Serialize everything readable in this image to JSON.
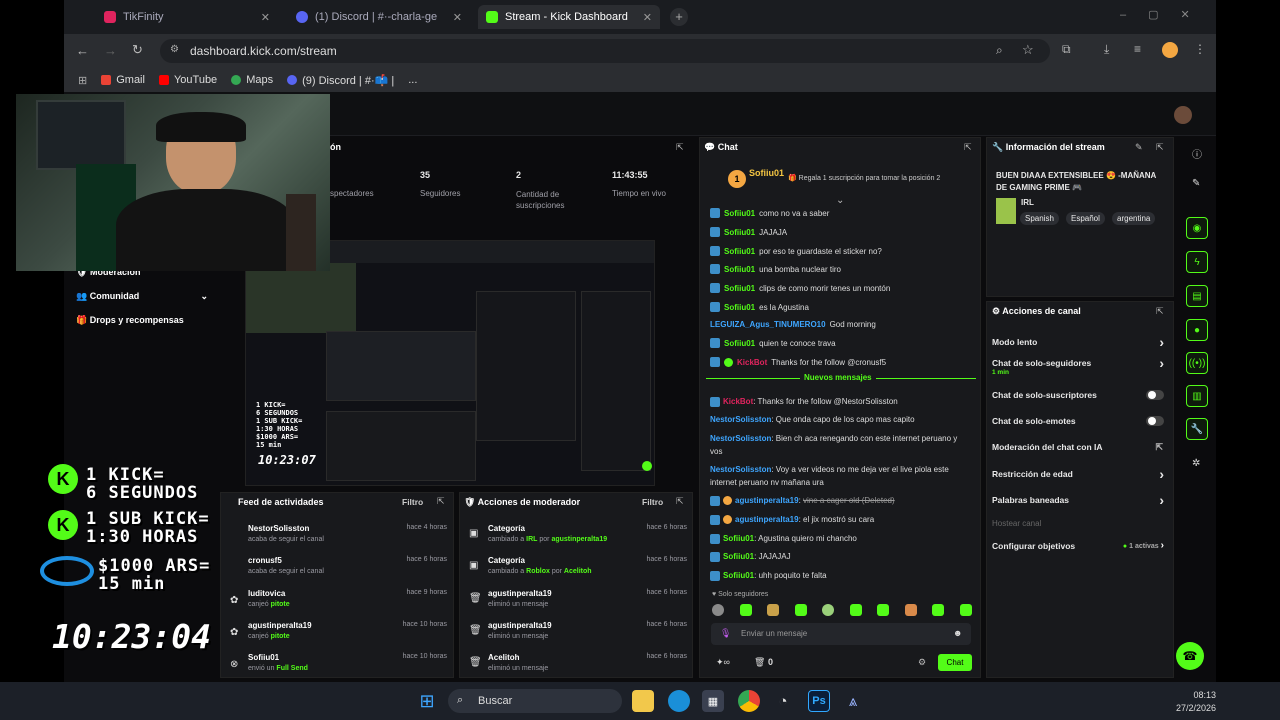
{
  "tabs": [
    {
      "label": "TikFinity",
      "color": "#e0245e"
    },
    {
      "label": "(1) Discord | #·-charla-ge",
      "color": "#e74c3c"
    },
    {
      "label": "Stream - Kick Dashboard",
      "color": "#53fc18"
    }
  ],
  "url": "dashboard.kick.com/stream",
  "bookmarks": [
    "Gmail",
    "YouTube",
    "Maps",
    "(9) Discord | #·📫 |"
  ],
  "bookmarks_more": "...",
  "overview": {
    "title_partial": "ón",
    "stats": [
      {
        "value": "",
        "label": "spectadores"
      },
      {
        "value": "35",
        "label": "Seguidores"
      },
      {
        "value": "2",
        "label": "Cantidad de suscripciones"
      },
      {
        "value": "11:43:55",
        "label": "Tiempo en vivo"
      }
    ]
  },
  "nav": [
    {
      "label": "Moderación"
    },
    {
      "label": "Comunidad"
    },
    {
      "label": "Drops y recompensas"
    }
  ],
  "chat": {
    "title": "Chat",
    "top_user": "Sofiiu01",
    "top_count": "1",
    "sub_prompt": "Regala 1 suscripción para tomar la posición 2",
    "messages": [
      {
        "user": "Sofiiu01",
        "text": "como no va a saber",
        "color": "#53fc18",
        "badge": true
      },
      {
        "user": "Sofiiu01",
        "text": "JAJAJA",
        "color": "#53fc18",
        "badge": true
      },
      {
        "user": "Sofiiu01",
        "text": "por eso te guardaste el sticker no?",
        "color": "#53fc18",
        "badge": true
      },
      {
        "user": "Sofiiu01",
        "text": "una bomba nuclear tiro",
        "color": "#53fc18",
        "badge": true
      },
      {
        "user": "Sofiiu01",
        "text": "clips de como morir tenes un montón",
        "color": "#53fc18",
        "badge": true
      },
      {
        "user": "Sofiiu01",
        "text": "es la Agustina",
        "color": "#53fc18",
        "badge": true
      },
      {
        "user": "LEGUIZA_Agus_TINUMERO10",
        "text": "God morning",
        "color": "#3ea6ff",
        "badge": false
      },
      {
        "user": "Sofiiu01",
        "text": "quien te conoce trava",
        "color": "#53fc18",
        "badge": true
      },
      {
        "user": "KickBot",
        "text": "Thanks for the follow @cronusf5",
        "color": "#e0245e",
        "badge": true
      }
    ],
    "new_messages": "Nuevos mensajes",
    "messages2": [
      {
        "user": "KickBot",
        "text": "Thanks for the follow @NestorSolisston",
        "color": "#e0245e"
      },
      {
        "user": "NestorSolisston",
        "text": "Que onda capo de los capo mas capito",
        "color": "#3ea6ff"
      },
      {
        "user": "NestorSolisston",
        "text": "Bien ch aca renegando con este internet peruano y vos",
        "color": "#3ea6ff"
      },
      {
        "user": "NestorSolisston",
        "text": "Voy a ver videos no me deja ver el live piola este internet peruano nv mañana ura",
        "color": "#3ea6ff"
      },
      {
        "user": "agustinperalta19",
        "text": "vine a cager old (Deleted)",
        "color": "#3ea6ff"
      },
      {
        "user": "agustinperalta19",
        "text": "el jix mostró su cara",
        "color": "#3ea6ff"
      },
      {
        "user": "Sofiiu01",
        "text": "Agustina quiero mi chancho",
        "color": "#53fc18"
      },
      {
        "user": "Sofiiu01",
        "text": "JAJAJAJ",
        "color": "#53fc18"
      },
      {
        "user": "Sofiiu01",
        "text": "uhh poquito te falta",
        "color": "#53fc18"
      }
    ],
    "followers_only": "Solo seguidores",
    "input_placeholder": "Enviar un mensaje",
    "counter": "0",
    "send_label": "Chat"
  },
  "stream_info": {
    "title": "Información del stream",
    "stream_title": "BUEN DIAAA EXTENSIBLEE 😍 -MAÑANA DE GAMING PRIME 🎮",
    "category": "IRL",
    "tags": [
      "Spanish",
      "Español",
      "argentina"
    ]
  },
  "channel_actions": {
    "title": "Acciones de canal",
    "items": [
      {
        "label": "Modo lento",
        "sub": "",
        "type": "arrow"
      },
      {
        "label": "Chat de solo-seguidores",
        "sub": "1 min",
        "type": "arrow"
      },
      {
        "label": "Chat de solo-suscriptores",
        "sub": "",
        "type": "toggle"
      },
      {
        "label": "Chat de solo-emotes",
        "sub": "",
        "type": "toggle"
      },
      {
        "label": "Moderación del chat con IA",
        "sub": "",
        "type": "ext"
      },
      {
        "label": "Restricción de edad",
        "sub": "",
        "type": "arrow"
      },
      {
        "label": "Palabras baneadas",
        "sub": "",
        "type": "arrow"
      }
    ],
    "section": "Hostear canal",
    "goals": "Configurar objetivos",
    "goals_status": "1 activas"
  },
  "activity": {
    "title": "Feed de actividades",
    "filter": "Filtro",
    "items": [
      {
        "name": "NestorSolisston",
        "action": "acaba de seguir el canal",
        "highlight": "",
        "time": "hace 4 horas"
      },
      {
        "name": "cronusf5",
        "action": "acaba de seguir el canal",
        "highlight": "",
        "time": "hace 6 horas"
      },
      {
        "name": "luditovica",
        "action": "canjeó",
        "highlight": "pitote",
        "time": "hace 9 horas"
      },
      {
        "name": "agustinperalta19",
        "action": "canjeó",
        "highlight": "pitote",
        "time": "hace 10 horas"
      },
      {
        "name": "Sofiiu01",
        "action": "envió un",
        "highlight": "Full Send",
        "time": "hace 10 horas"
      }
    ]
  },
  "modactions": {
    "title": "Acciones de moderador",
    "filter": "Filtro",
    "items": [
      {
        "name": "Categoría",
        "pre": "cambiado a",
        "hl": "IRL",
        "mid": "por",
        "hl2": "agustinperalta19",
        "time": "hace 6 horas",
        "icon": "▣"
      },
      {
        "name": "Categoría",
        "pre": "cambiado a",
        "hl": "Roblox",
        "mid": "por",
        "hl2": "Acelitoh",
        "time": "hace 6 horas",
        "icon": "▣"
      },
      {
        "name": "agustinperalta19",
        "pre": "eliminó un mensaje",
        "hl": "",
        "mid": "",
        "hl2": "",
        "time": "hace 6 horas",
        "icon": "🗑"
      },
      {
        "name": "agustinperalta19",
        "pre": "eliminó un mensaje",
        "hl": "",
        "mid": "",
        "hl2": "",
        "time": "hace 6 horas",
        "icon": "🗑"
      },
      {
        "name": "Acelitoh",
        "pre": "eliminó un mensaje",
        "hl": "",
        "mid": "",
        "hl2": "",
        "time": "hace 6 horas",
        "icon": "🗑"
      }
    ]
  },
  "overlay": {
    "line1a": "1 KICK=",
    "line1b": "6 SEGUNDOS",
    "line2a": "1 SUB KICK=",
    "line2b": "1:30 HORAS",
    "line3a": "$1000 ARS=",
    "line3b": "15 min",
    "clock": "10:23:04",
    "preview_clock": "10:23:07"
  },
  "taskbar": {
    "search": "Buscar",
    "time": "08:13",
    "date": "27/2/2026"
  }
}
